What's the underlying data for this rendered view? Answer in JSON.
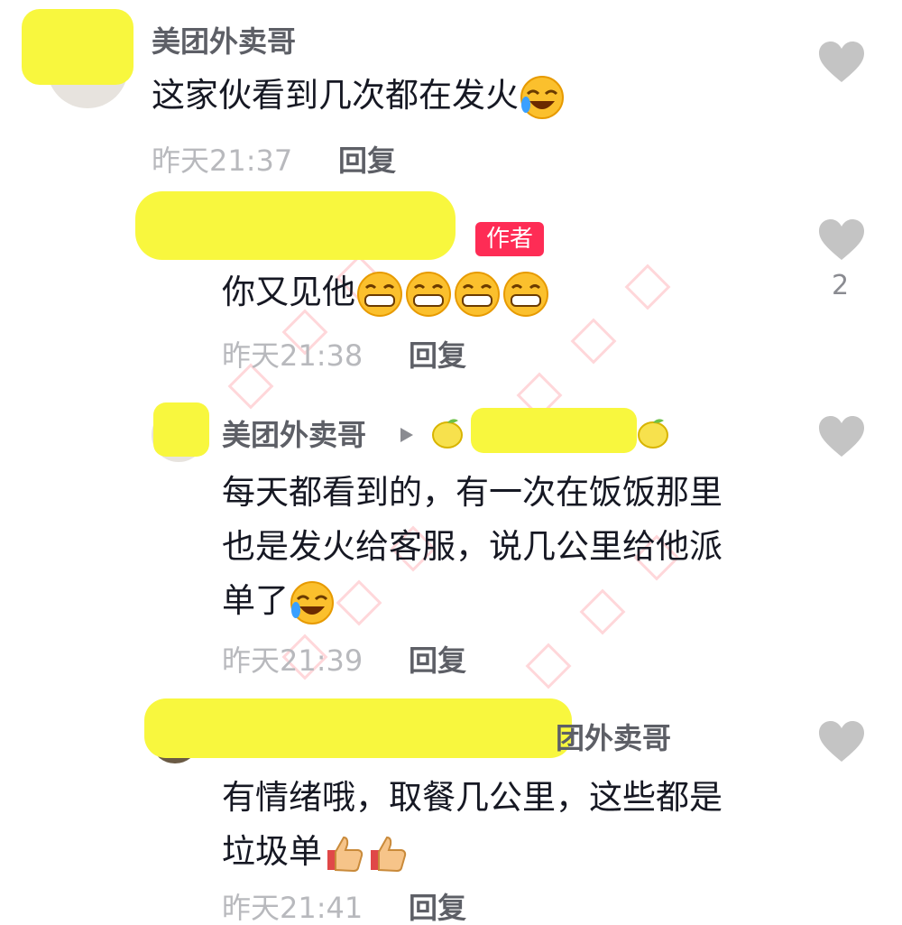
{
  "comments": [
    {
      "author": "美团外卖哥",
      "text": "这家伙看到几次都在发火",
      "time": "昨天21:37",
      "reply_label": "回复",
      "like_count": ""
    },
    {
      "author_badge": "作者",
      "text": "你又见他",
      "time": "昨天21:38",
      "reply_label": "回复",
      "like_count": "2"
    },
    {
      "author": "美团外卖哥",
      "text_line1": "每天都看到的，有一次在饭饭那里",
      "text_line2": "也是发火给客服，说几公里给他派",
      "text_line3": "单了",
      "time": "昨天21:39",
      "reply_label": "回复",
      "like_count": ""
    },
    {
      "author_visible": "团外卖哥",
      "text_line1": "有情绪哦，取餐几公里，这些都是",
      "text_line2": "垃圾单",
      "time": "昨天21:41",
      "reply_label": "回复",
      "like_count": ""
    }
  ],
  "icons": {
    "like": "heart-icon",
    "laugh_cry": "laughing-crying-emoji",
    "grin": "grinning-emoji",
    "thumbs_up": "thumbs-up-emoji",
    "lemon": "lemon-emoji",
    "arrow": "reply-arrow-icon"
  },
  "colors": {
    "badge": "#fe2c55",
    "redaction": "#f8f73e",
    "heart": "#c4c4c4"
  }
}
